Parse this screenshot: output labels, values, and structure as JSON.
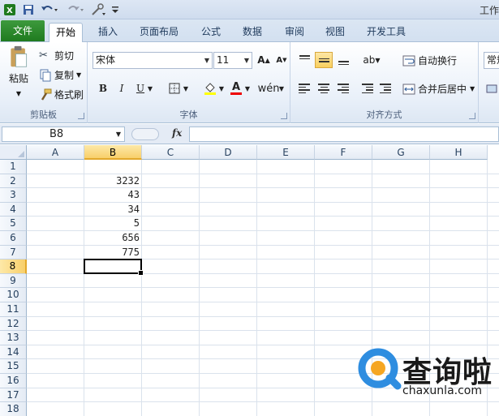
{
  "qat": {
    "title_fragment": "工作"
  },
  "tabs": [
    {
      "label": "文件"
    },
    {
      "label": "开始"
    },
    {
      "label": "插入"
    },
    {
      "label": "页面布局"
    },
    {
      "label": "公式"
    },
    {
      "label": "数据"
    },
    {
      "label": "审阅"
    },
    {
      "label": "视图"
    },
    {
      "label": "开发工具"
    }
  ],
  "ribbon": {
    "clipboard": {
      "paste": "粘贴",
      "cut": "剪切",
      "copy": "复制",
      "format_painter": "格式刷",
      "label": "剪贴板"
    },
    "font": {
      "name": "宋体",
      "size": "11",
      "bold": "B",
      "italic": "I",
      "underline": "U",
      "label": "字体"
    },
    "alignment": {
      "wrap_text": "自动换行",
      "merge_center": "合并后居中",
      "label": "对齐方式"
    },
    "number": {
      "format": "常规"
    }
  },
  "formula_bar": {
    "name_box": "B8",
    "fx": "fx",
    "formula": ""
  },
  "grid": {
    "columns": [
      "A",
      "B",
      "C",
      "D",
      "E",
      "F",
      "G",
      "H"
    ],
    "rows": [
      "1",
      "2",
      "3",
      "4",
      "5",
      "6",
      "7",
      "8",
      "9",
      "10",
      "11",
      "12",
      "13",
      "14",
      "15",
      "16",
      "17",
      "18"
    ],
    "selected_column": "B",
    "selected_row": "8",
    "cells": [
      {
        "ref": "B2",
        "value": "3232"
      },
      {
        "ref": "B3",
        "value": "43"
      },
      {
        "ref": "B4",
        "value": "34"
      },
      {
        "ref": "B5",
        "value": "5"
      },
      {
        "ref": "B6",
        "value": "656"
      },
      {
        "ref": "B7",
        "value": "775"
      }
    ]
  },
  "watermark": {
    "title": "查询啦",
    "url": "chaxunla.com"
  },
  "colors": {
    "file_tab": "#2a8a2a",
    "selection_header": "#f8cf6a",
    "watermark_blue": "#2e8de0",
    "watermark_orange": "#f5a623"
  }
}
